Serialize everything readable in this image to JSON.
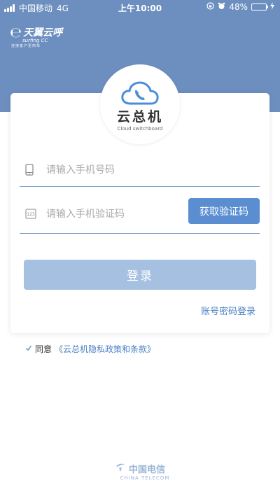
{
  "status_bar": {
    "carrier": "中国移动",
    "network": "4G",
    "time": "上午10:00",
    "battery_text": "48%",
    "battery_level": 0.48
  },
  "brand": {
    "logo_icon": "e-icon",
    "name": "天翼云呼",
    "sub": "surfing CC",
    "tag": "连接客户更简单"
  },
  "app_logo": {
    "icon": "cloud-phone-icon",
    "title": "云总机",
    "subtitle": "Cloud switchboard"
  },
  "form": {
    "phone_placeholder": "请输入手机号码",
    "phone_value": "",
    "code_placeholder": "请输入手机验证码",
    "code_value": "",
    "get_code_label": "获取验证码",
    "login_label": "登录",
    "password_login_label": "账号密码登录"
  },
  "agreement": {
    "checked": true,
    "prefix": "同意",
    "policy_link": "《云总机隐私政策和条款》"
  },
  "footer": {
    "logo_name": "中国电信",
    "logo_sub": "CHINA TELECOM"
  },
  "colors": {
    "header": "#6d8fc0",
    "accent": "#5b8ed1",
    "login_disabled": "#a6c0e1",
    "link": "#4c7fc5"
  }
}
